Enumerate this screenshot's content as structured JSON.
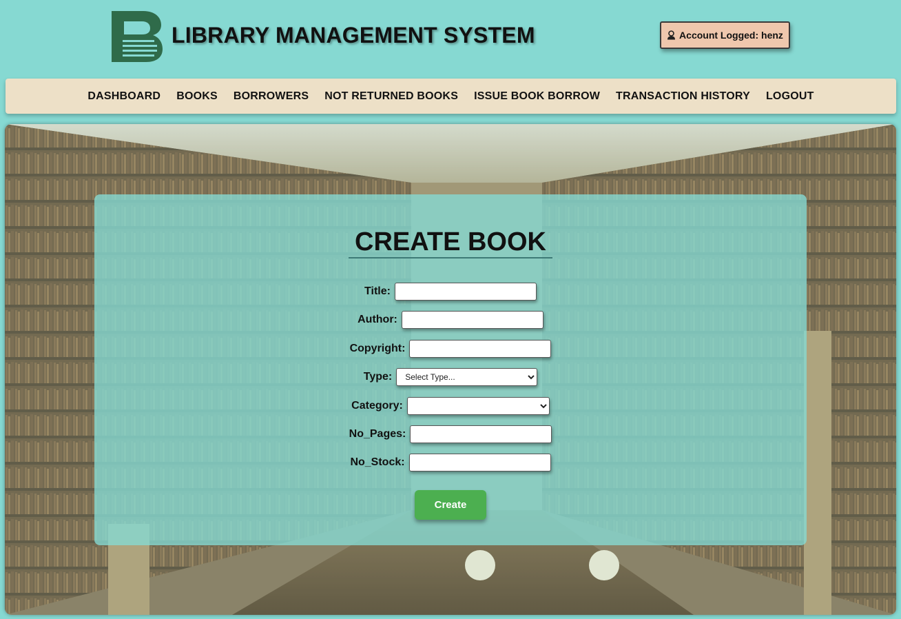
{
  "header": {
    "title": "LIBRARY MANAGEMENT SYSTEM",
    "account_label": "Account Logged: henz"
  },
  "nav": {
    "dashboard": "DASHBOARD",
    "books": "BOOKS",
    "borrowers": "BORROWERS",
    "not_returned": "NOT RETURNED BOOKS",
    "issue_book": "ISSUE BOOK BORROW",
    "transaction_history": "TRANSACTION HISTORY",
    "logout": "LOGOUT"
  },
  "form": {
    "heading": "CREATE BOOK",
    "title_label": "Title:",
    "author_label": "Author:",
    "copyright_label": "Copyright:",
    "type_label": "Type:",
    "type_selected": "Select Type...",
    "category_label": "Category:",
    "category_selected": "",
    "pages_label": "No_Pages:",
    "stock_label": "No_Stock:",
    "submit_label": "Create"
  },
  "colors": {
    "page_background": "#86d9d2",
    "navbar_background": "#ede0c7",
    "account_badge": "#efc7ad",
    "logo": "#2f6b4a",
    "create_button": "#4caf50"
  },
  "icons": {
    "logo": "library-logo",
    "account": "user-icon"
  }
}
